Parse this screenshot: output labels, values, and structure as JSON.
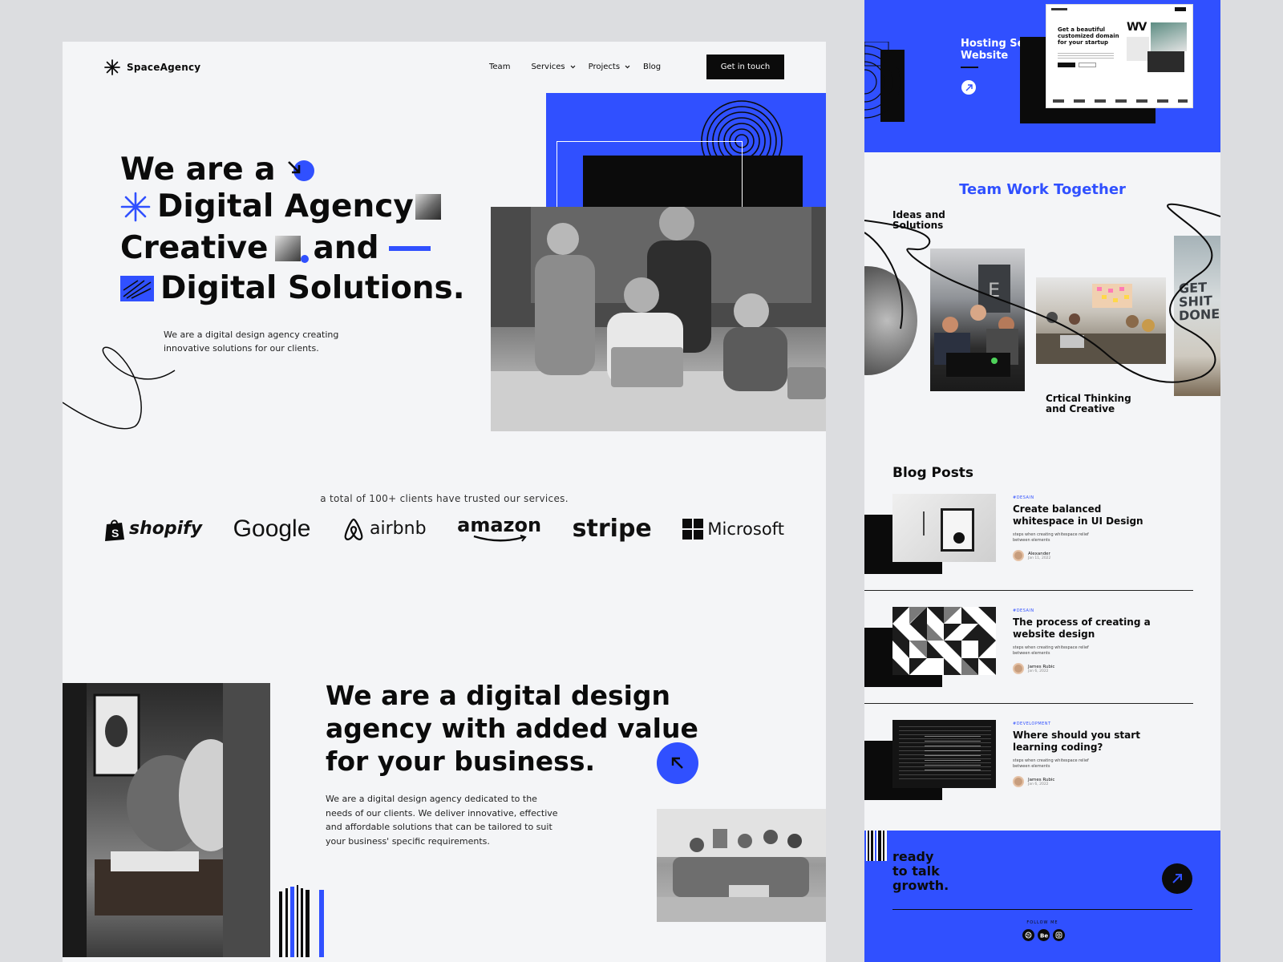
{
  "nav": {
    "brand": "SpaceAgency",
    "links": [
      "Team",
      "Services",
      "Projects",
      "Blog"
    ],
    "cta": "Get in touch"
  },
  "hero": {
    "line1": "We are a",
    "line2": "Digital Agency",
    "line3a": "Creative",
    "line3b": "and",
    "line4": "Digital Solutions.",
    "subtitle": "We are a digital design agency creating innovative solutions for our clients."
  },
  "clients": {
    "caption": "a total of 100+ clients have trusted our services.",
    "logos": [
      "shopify",
      "Google",
      "airbnb",
      "amazon",
      "stripe",
      "Microsoft"
    ]
  },
  "about": {
    "title_lines": [
      "We are a digital design",
      "agency with added value",
      "for your business."
    ],
    "text": "We are a digital design agency dedicated to the needs of our clients. We deliver innovative, effective and affordable solutions that can be tailored to suit your business' specific requirements."
  },
  "right": {
    "hosting_title_lines": [
      "Hosting Service",
      "Website"
    ],
    "preview": {
      "headline_lines": [
        "Get a beautiful",
        "customized domain",
        "for your startup"
      ],
      "brand_mark": "WV"
    },
    "team_title": "Team Work Together",
    "label_ideas_lines": [
      "Ideas and",
      "Solutions"
    ],
    "label_critical_lines": [
      "Crtical Thinking",
      "and Creative"
    ],
    "poster_text_lines": [
      "GET",
      "SHIT",
      "DONE."
    ],
    "blog_title": "Blog Posts",
    "posts": [
      {
        "tag": "#DESAIN",
        "title": "Create balanced whitespace in UI Design",
        "desc": "steps when creating whitespace relief between elements",
        "author": "Alexander",
        "date": "Jan 11, 2022"
      },
      {
        "tag": "#DESAIN",
        "title": "The process of creating a website design",
        "desc": "steps when creating whitespace relief between elements",
        "author": "James Rubic",
        "date": "Jan 6, 2022"
      },
      {
        "tag": "#DEVELOPMENT",
        "title": "Where should you start learning coding?",
        "desc": "steps when creating whitespace relief between elements",
        "author": "James Rubic",
        "date": "Jan 6, 2022"
      }
    ],
    "cta_lines": [
      "ready",
      "to talk",
      "growth."
    ],
    "follow_label": "FOLLOW ME",
    "social_icons": [
      "dribbble-icon",
      "behance-icon",
      "instagram-icon"
    ]
  },
  "colors": {
    "accent": "#3050ff",
    "dark": "#0b0b0b",
    "panel": "#f4f5f7",
    "background": "#dcdde0"
  }
}
